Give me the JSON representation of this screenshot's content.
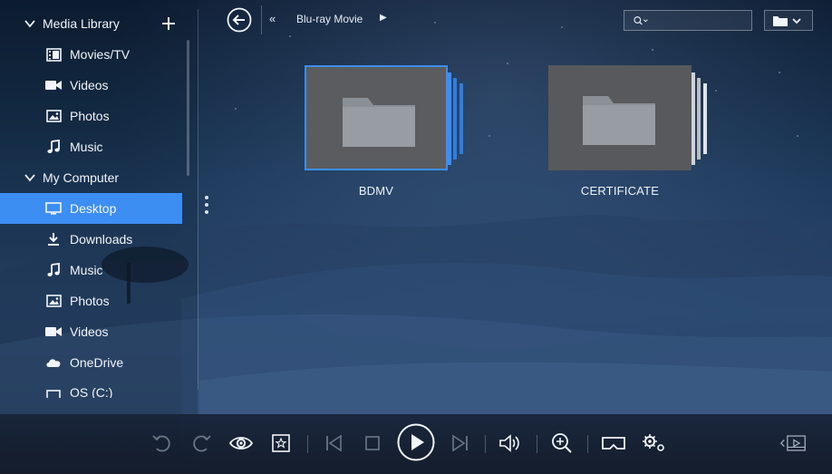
{
  "sidebar": {
    "items": [
      {
        "label": "Media Library",
        "type": "group"
      },
      {
        "label": "Movies/TV",
        "type": "sub",
        "icon": "film-icon"
      },
      {
        "label": "Videos",
        "type": "sub",
        "icon": "video-camera-icon"
      },
      {
        "label": "Photos",
        "type": "sub",
        "icon": "photo-icon"
      },
      {
        "label": "Music",
        "type": "sub",
        "icon": "music-note-icon"
      },
      {
        "label": "My Computer",
        "type": "group"
      },
      {
        "label": "Desktop",
        "type": "sub",
        "icon": "monitor-icon",
        "active": true
      },
      {
        "label": "Downloads",
        "type": "sub",
        "icon": "download-icon"
      },
      {
        "label": "Music",
        "type": "sub",
        "icon": "music-note-icon"
      },
      {
        "label": "Photos",
        "type": "sub",
        "icon": "photo-icon"
      },
      {
        "label": "Videos",
        "type": "sub",
        "icon": "video-camera-icon"
      },
      {
        "label": "OneDrive",
        "type": "sub",
        "icon": "cloud-icon"
      },
      {
        "label": "OS (C:)",
        "type": "sub",
        "icon": "drive-icon"
      }
    ]
  },
  "header": {
    "breadcrumb_prev": "«",
    "breadcrumb_current": "Blu-ray Movie",
    "breadcrumb_next": "▶",
    "search_value": ""
  },
  "folders": [
    {
      "name": "BDMV",
      "selected": true
    },
    {
      "name": "CERTIFICATE",
      "selected": false
    }
  ],
  "colors": {
    "accent": "#3d8ef2",
    "folder_card": "#58595c",
    "folder_icon": "#8a9096"
  },
  "toolbar": {
    "buttons": [
      "undo-icon",
      "redo-icon",
      "eye-icon",
      "bookmark-star-icon",
      "previous-track-icon",
      "stop-icon",
      "play-icon",
      "next-track-icon",
      "volume-icon",
      "zoom-in-icon",
      "vr-headset-icon",
      "settings-gears-icon",
      "mini-player-icon"
    ]
  }
}
